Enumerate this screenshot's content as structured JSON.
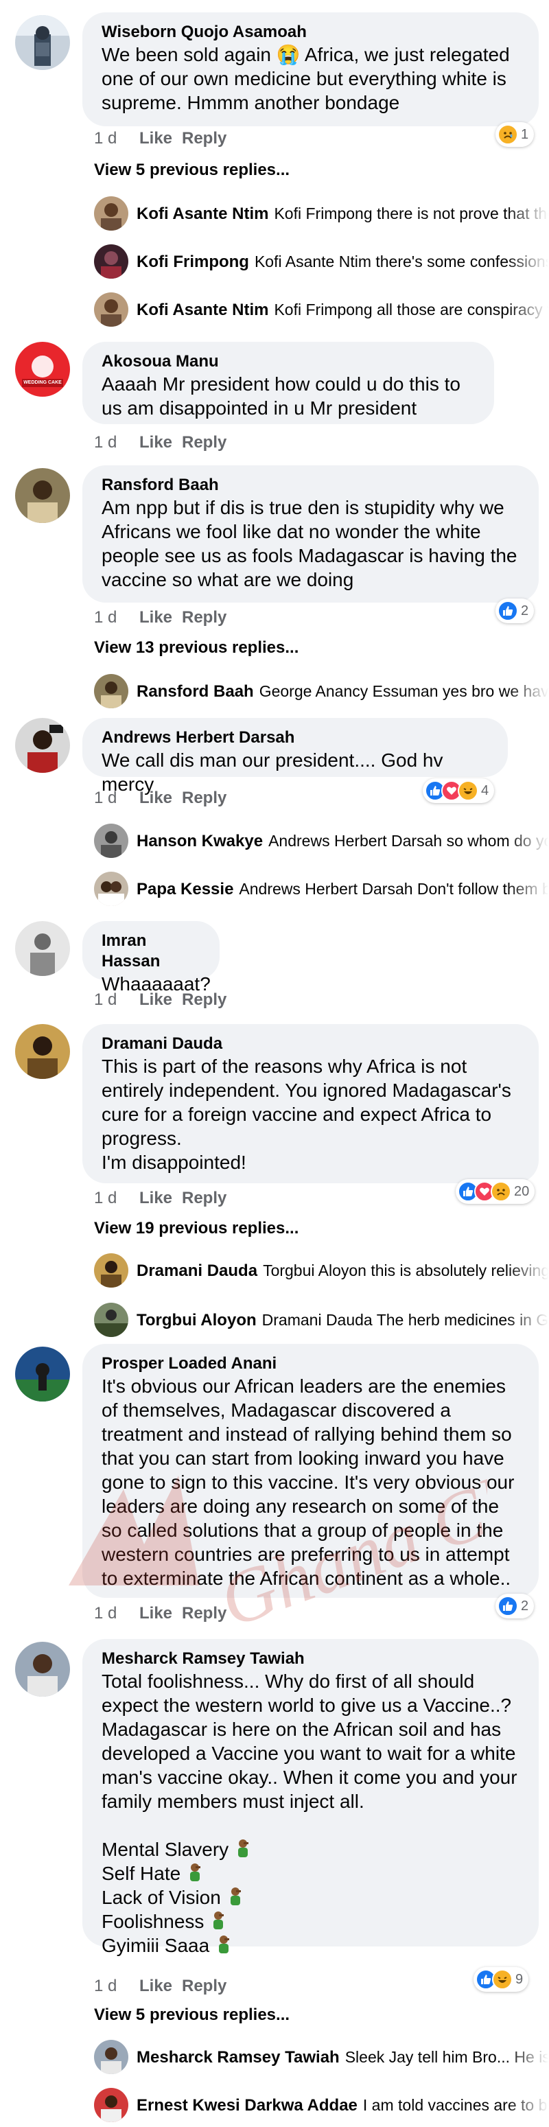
{
  "ui": {
    "time": "1 d",
    "like": "Like",
    "reply": "Reply"
  },
  "comments": [
    {
      "author": "Wiseborn Quojo Asamoah",
      "text": "We been sold again 😭 Africa, we just relegated one of our own medicine but everything white is supreme. Hmmm another bondage",
      "reactions": [
        "sad"
      ],
      "reaction_count": "1",
      "view_more": "View 5 previous replies...",
      "replies": [
        {
          "author": "Kofi Asante Ntim",
          "text": "Kofi Frimpong there is not prove that the herbs works"
        },
        {
          "author": "Kofi Frimpong",
          "text": "Kofi Asante Ntim there's some confessions from people"
        },
        {
          "author": "Kofi Asante Ntim",
          "text": "Kofi Frimpong  all those are conspiracy theories"
        }
      ]
    },
    {
      "author": "Akosoua Manu",
      "text": "Aaaah Mr president how could u do this to us am disappointed in u Mr president",
      "avatar_label": "WEDDING CAKE",
      "replies": []
    },
    {
      "author": "Ransford Baah",
      "text": "Am npp but if dis is true den is stupidity why we Africans we fool like dat no wonder the white people see us as fools Madagascar is having the vaccine so what are we doing",
      "reactions": [
        "like"
      ],
      "reaction_count": "2",
      "view_more": "View 13 previous replies...",
      "replies": [
        {
          "author": "Ransford Baah",
          "text": "George Anancy Essuman yes bro we have to"
        }
      ]
    },
    {
      "author": "Andrews Herbert Darsah",
      "text": "We call dis man our president.... God hv mercy",
      "reactions": [
        "like",
        "love",
        "haha"
      ],
      "reaction_count": "4",
      "replies": [
        {
          "author": "Hanson Kwakye",
          "text": "Andrews Herbert Darsah so whom do you call"
        },
        {
          "author": "Papa Kessie",
          "text": "Andrews Herbert Darsah Don't follow them blindly"
        }
      ]
    },
    {
      "author": "Imran Hassan",
      "text": "Whaaaaaat?",
      "replies": []
    },
    {
      "author": "Dramani Dauda",
      "text": "This is part of the reasons why Africa is not entirely independent. You ignored Madagascar's cure for a foreign vaccine and expect Africa to progress.\nI'm disappointed!",
      "reactions": [
        "like",
        "love",
        "sad"
      ],
      "reaction_count": "20",
      "view_more": "View 19 previous replies...",
      "replies": [
        {
          "author": "Dramani Dauda",
          "text": "Torgbui Aloyon this is absolutely relieving to hear"
        },
        {
          "author": "Torgbui Aloyon",
          "text": "Dramani Dauda The herb medicines in Ghana are many"
        }
      ]
    },
    {
      "author": "Prosper Loaded Anani",
      "text": "It's obvious our African leaders are the enemies of themselves, Madagascar discovered a treatment and instead of rallying behind them so that you can start from looking inward you have gone to sign to this vaccine. It's very obvious our leaders are doing any research on some of the so called solutions that a group of people in the western countries are preferring to us in attempt to exterminate the African continent as a whole..",
      "reactions": [
        "like"
      ],
      "reaction_count": "2",
      "replies": []
    },
    {
      "author": "Mesharck Ramsey Tawiah",
      "text": "Total foolishness... Why do first of all should expect the western world to give us a Vaccine..? Madagascar is here on the African soil and has developed a Vaccine you want to wait for a white man's vaccine okay.. When it come you and your family members must inject all.",
      "list": [
        "Mental Slavery",
        "Self Hate",
        "Lack of Vision",
        "Foolishness",
        "Gyimiii Saaa"
      ],
      "reactions": [
        "like",
        "haha"
      ],
      "reaction_count": "9",
      "view_more": "View 5 previous replies...",
      "replies": [
        {
          "author": "Mesharck Ramsey Tawiah",
          "text": "Sleek Jay tell him Bro... He is wasting time"
        },
        {
          "author": "Ernest Kwesi Darkwa Addae",
          "text": "I am told vaccines are to be"
        }
      ]
    }
  ],
  "watermark": "Ghana Clouds",
  "colors": {
    "bubble": "#f0f2f5",
    "meta": "#65676b",
    "like": "#1877f2",
    "love": "#f33e58",
    "emoji": "#f7b125"
  }
}
